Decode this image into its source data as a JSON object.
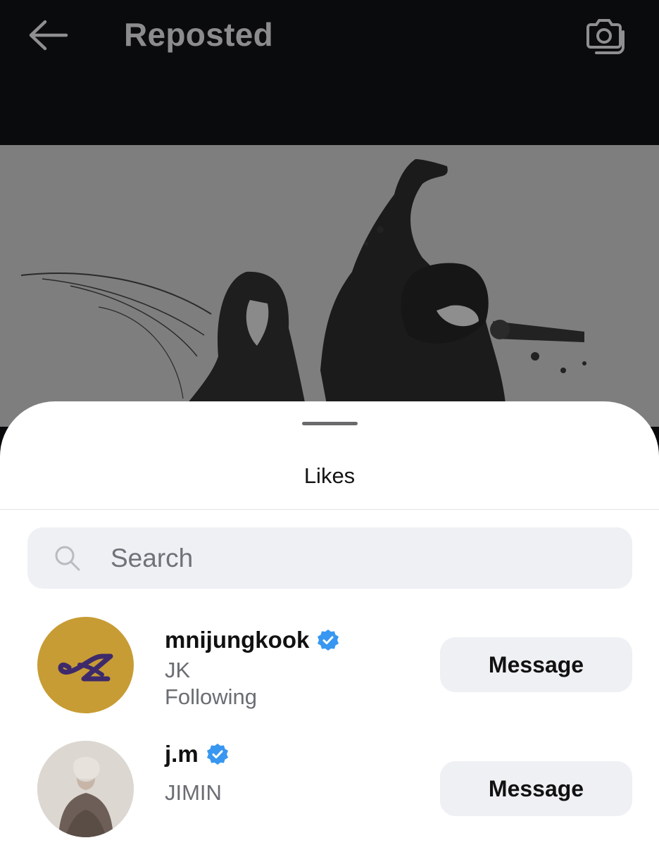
{
  "header": {
    "title": "Reposted",
    "back_icon": "arrow-left-icon",
    "camera_icon": "camera-icon"
  },
  "sheet": {
    "title": "Likes",
    "search": {
      "placeholder": "Search",
      "icon": "search-icon"
    }
  },
  "likes": [
    {
      "username": "mnijungkook",
      "verified": true,
      "full_name": "JK",
      "status": "Following",
      "button_label": "Message",
      "avatar_color": "#c79c34"
    },
    {
      "username": "j.m",
      "verified": true,
      "full_name": "JIMIN",
      "status": "",
      "button_label": "Message",
      "avatar_color": "#d8d4cf"
    }
  ],
  "colors": {
    "header_bg": "#0a0b0d",
    "verified_blue": "#3897f0",
    "button_bg": "#eff0f4"
  }
}
